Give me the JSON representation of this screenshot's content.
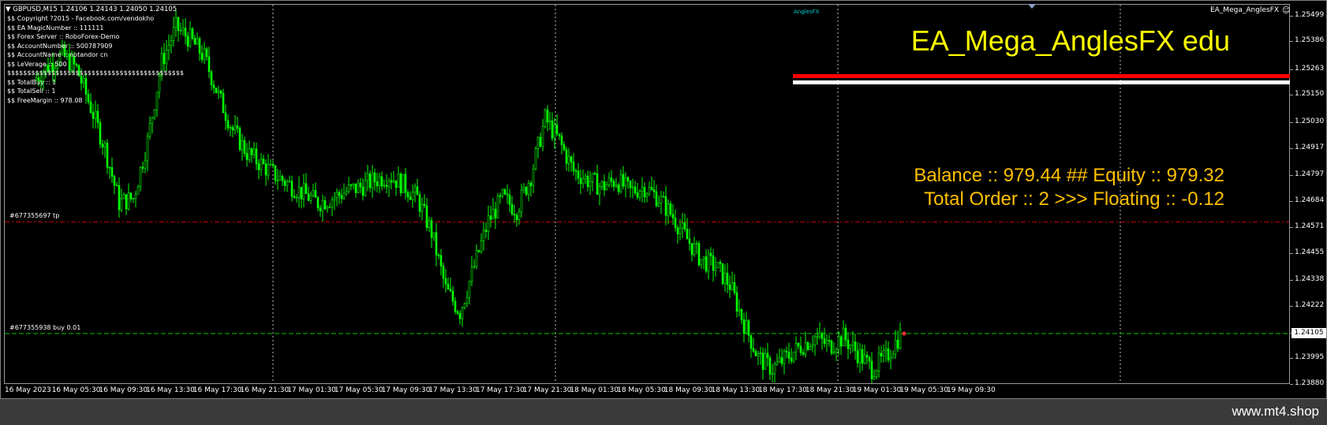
{
  "chart": {
    "symbol_header": "GBPUSD,M15  1.24106 1.24143 1.24050 1.24105",
    "ea_name_top_right": "EA_Mega_AnglesFX",
    "small_label": "AnglesFX",
    "colors": {
      "background": "#000000",
      "candle": "#00ff00",
      "title": "#ffff00",
      "stats": "#ffc000",
      "tp_line": "#cc0000",
      "order_line": "#00cc00",
      "bar_red": "#ff0000",
      "bar_white": "#ffffff"
    }
  },
  "info_lines": [
    "$$ Copyright ?2015 - Facebook.com/vendokho",
    "$$ EA MagicNumber :: 111111",
    "$$ Forex Server :: RoboForex-Demo",
    "$$ AccountNumber :: 500787909",
    "$$ AccountName :: notandor cn",
    "$$ LeVerage :: 500",
    "$$$$$$$$$$$$$$$$$$$$$$$$$$$$$$$$$$$$$$$$$$$$",
    "$$ TotalBuy :: 1",
    "$$ TotalSell :: 1",
    "$$ FreeMargin :: 978.08"
  ],
  "ea_title": "EA_Mega_AnglesFX edu",
  "stats": {
    "line1": "Balance :: 979.44 ## Equity :: 979.32",
    "line2": "Total Order :: 2    >>> Floating :: -0.12"
  },
  "orders": {
    "tp_label": "#677355697 tp",
    "order_label": "#677355938 buy 0.01",
    "tp_price": 1.24596,
    "order_price": 1.24105
  },
  "y_axis": {
    "ticks": [
      "1.25499",
      "1.25386",
      "1.25263",
      "1.25150",
      "1.25030",
      "1.24917",
      "1.24797",
      "1.24684",
      "1.24571",
      "1.24455",
      "1.24338",
      "1.24222",
      "1.24105",
      "1.23995",
      "1.23880"
    ],
    "current_price": "1.24105"
  },
  "x_axis": {
    "ticks": [
      "16 May 2023",
      "16 May 05:30",
      "16 May 09:30",
      "16 May 13:30",
      "16 May 17:30",
      "16 May 21:30",
      "17 May 01:30",
      "17 May 05:30",
      "17 May 09:30",
      "17 May 13:30",
      "17 May 17:30",
      "17 May 21:30",
      "18 May 01:30",
      "18 May 05:30",
      "18 May 09:30",
      "18 May 13:30",
      "18 May 17:30",
      "18 May 21:30",
      "19 May 01:30",
      "19 May 05:30",
      "19 May 09:30"
    ]
  },
  "chart_data": {
    "type": "candlestick",
    "series": [
      {
        "name": "GBPUSD M15",
        "close": [
          1.2522,
          1.2528,
          1.2533,
          1.2527,
          1.251,
          1.2492,
          1.2468,
          1.247,
          1.2495,
          1.253,
          1.2545,
          1.254,
          1.2532,
          1.2515,
          1.25,
          1.249,
          1.2485,
          1.248,
          1.2476,
          1.2472,
          1.2468,
          1.247,
          1.2473,
          1.2475,
          1.2478,
          1.248,
          1.2476,
          1.247,
          1.2455,
          1.243,
          1.242,
          1.244,
          1.246,
          1.247,
          1.2465,
          1.248,
          1.2505,
          1.2495,
          1.2482,
          1.2478,
          1.2475,
          1.2478,
          1.2473,
          1.2475,
          1.247,
          1.2462,
          1.2452,
          1.2443,
          1.244,
          1.2432,
          1.2415,
          1.24,
          1.2395,
          1.24,
          1.2405,
          1.2409,
          1.2405,
          1.2409,
          1.2402,
          1.2395,
          1.24,
          1.241
        ]
      }
    ],
    "ylim": [
      1.2388,
      1.2555
    ]
  },
  "watermark": "www.mt4.shop"
}
